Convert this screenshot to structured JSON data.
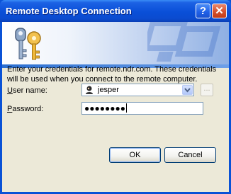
{
  "window": {
    "title": "Remote Desktop Connection"
  },
  "titlebar": {
    "help_label": "?",
    "close_label": "✕"
  },
  "banner": {
    "icon": "keys-icon",
    "watermark": "computer-watermark-icon"
  },
  "message": "Enter your credentials for remote.ndr.com. These credentials will be used when you connect to the remote computer.",
  "form": {
    "username_label_underlined": "U",
    "username_label_rest": "ser name:",
    "username_value": "jesper",
    "browse_label": "...",
    "password_label_underlined": "P",
    "password_label_rest": "assword:",
    "password_value": "●●●●●●●●"
  },
  "buttons": {
    "ok": "OK",
    "cancel": "Cancel"
  },
  "colors": {
    "titlebar": "#0a4fd8",
    "client": "#ece9d8",
    "accent": "#2b6fd1"
  }
}
